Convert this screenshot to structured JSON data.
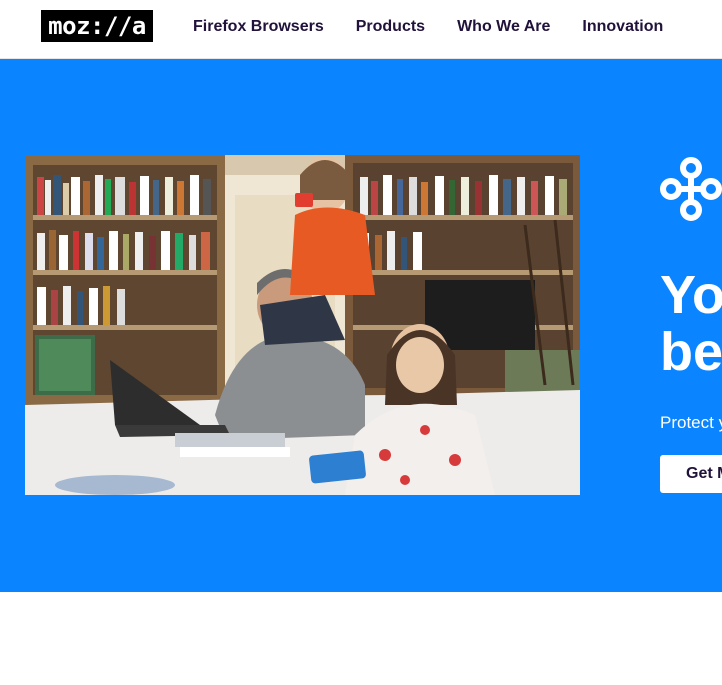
{
  "header": {
    "logo_text": "moz://a",
    "nav": [
      {
        "label": "Firefox Browsers"
      },
      {
        "label": "Products"
      },
      {
        "label": "Who We Are"
      },
      {
        "label": "Innovation"
      }
    ]
  },
  "hero": {
    "icon": "mozilla-vpn-nodes-icon",
    "headline_line1": "Yo",
    "headline_line2": "be",
    "subtext": "Protect y",
    "cta_label": "Get M",
    "photo_alt": "family-at-home-with-laptop-and-phones",
    "colors": {
      "background": "#0a84ff",
      "text": "#ffffff",
      "nav_text": "#20123a"
    }
  }
}
